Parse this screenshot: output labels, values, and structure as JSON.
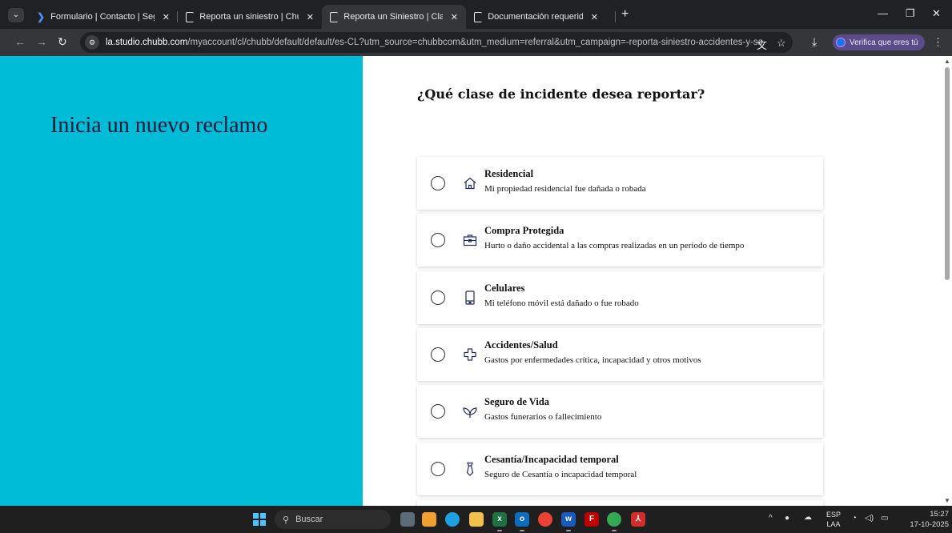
{
  "browser": {
    "tabs": [
      {
        "title": "Formulario | Contacto | Seguros",
        "favicon": "chubb-wave-icon",
        "active": false
      },
      {
        "title": "Reporta un siniestro | Chubb",
        "favicon": "chubb-logo-icon",
        "active": false
      },
      {
        "title": "Reporta un Siniestro | Claims",
        "favicon": "chubb-logo-icon",
        "active": true
      },
      {
        "title": "Documentación requerida para",
        "favicon": "chubb-logo-icon",
        "active": false
      }
    ],
    "close_glyph": "✕",
    "new_tab_glyph": "+",
    "url_host": "la.studio.chubb.com",
    "url_path": "/myaccount/cl/chubb/default/default/es-CL?utm_source=chubbcom&utm_medium=referral&utm_campaign=-reporta-siniestro-accidentes-y-salud-cl",
    "verify_label": "Verifica que eres tú"
  },
  "page": {
    "left_heading": "Inicia un nuevo reclamo",
    "question": "¿Qué clase de incidente desea reportar?",
    "options": [
      {
        "title": "Residencial",
        "description": "Mi propiedad residencial fue dañada o robada",
        "icon": "house-icon",
        "selected": false
      },
      {
        "title": "Compra Protegida",
        "description": "Hurto o daño accidental a las compras realizadas en un periodo de tiempo",
        "icon": "briefcase-icon",
        "selected": false
      },
      {
        "title": "Celulares",
        "description": "Mi teléfono móvil está dañado o fue robado",
        "icon": "phone-icon",
        "selected": false
      },
      {
        "title": "Accidentes/Salud",
        "description": "Gastos por enfermedades crítica, incapacidad y otros motivos",
        "icon": "medical-cross-icon",
        "selected": false
      },
      {
        "title": "Seguro de Vida",
        "description": "Gastos funerarios o fallecimiento",
        "icon": "leaves-icon",
        "selected": false
      },
      {
        "title": "Cesantía/Incapacidad temporal",
        "description": "Seguro de Cesantía o incapacidad temporal",
        "icon": "tie-icon",
        "selected": false
      }
    ]
  },
  "taskbar": {
    "search_label": "Buscar",
    "lang_primary": "ESP",
    "lang_secondary": "LAA",
    "time": "15:27",
    "date": "17-10-2025"
  },
  "colors": {
    "brand_cyan": "#00bcd6",
    "heading_navy": "#0e1a3b",
    "icon_navy": "#1f2a6b"
  }
}
